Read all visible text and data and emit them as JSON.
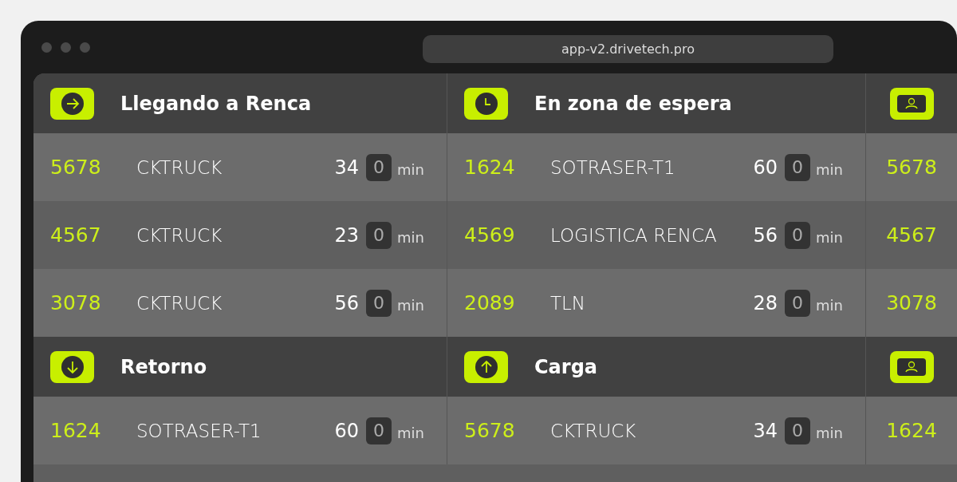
{
  "browser": {
    "url": "app-v2.drivetech.pro"
  },
  "bands": [
    {
      "panels": [
        {
          "kind": "full",
          "title": "Llegando a Renca",
          "rows": [
            {
              "id": "5678",
              "company": "CKTRUCK",
              "minutes": "34",
              "counter": "0",
              "unit": "min"
            },
            {
              "id": "4567",
              "company": "CKTRUCK",
              "minutes": "23",
              "counter": "0",
              "unit": "min"
            },
            {
              "id": "3078",
              "company": "CKTRUCK",
              "minutes": "56",
              "counter": "0",
              "unit": "min"
            }
          ]
        },
        {
          "kind": "full",
          "title": "En zona de espera",
          "rows": [
            {
              "id": "1624",
              "company": "SOTRASER-T1",
              "minutes": "60",
              "counter": "0",
              "unit": "min"
            },
            {
              "id": "4569",
              "company": "LOGISTICA RENCA",
              "minutes": "56",
              "counter": "0",
              "unit": "min"
            },
            {
              "id": "2089",
              "company": "TLN",
              "minutes": "28",
              "counter": "0",
              "unit": "min"
            }
          ]
        },
        {
          "kind": "id_only",
          "rows": [
            {
              "id": "5678"
            },
            {
              "id": "4567"
            },
            {
              "id": "3078"
            }
          ]
        }
      ]
    },
    {
      "panels": [
        {
          "kind": "full",
          "title": "Retorno",
          "rows": [
            {
              "id": "1624",
              "company": "SOTRASER-T1",
              "minutes": "60",
              "counter": "0",
              "unit": "min"
            }
          ]
        },
        {
          "kind": "full",
          "title": "Carga",
          "rows": [
            {
              "id": "5678",
              "company": "CKTRUCK",
              "minutes": "34",
              "counter": "0",
              "unit": "min"
            }
          ]
        },
        {
          "kind": "id_only",
          "rows": [
            {
              "id": "1624"
            }
          ]
        }
      ]
    }
  ]
}
